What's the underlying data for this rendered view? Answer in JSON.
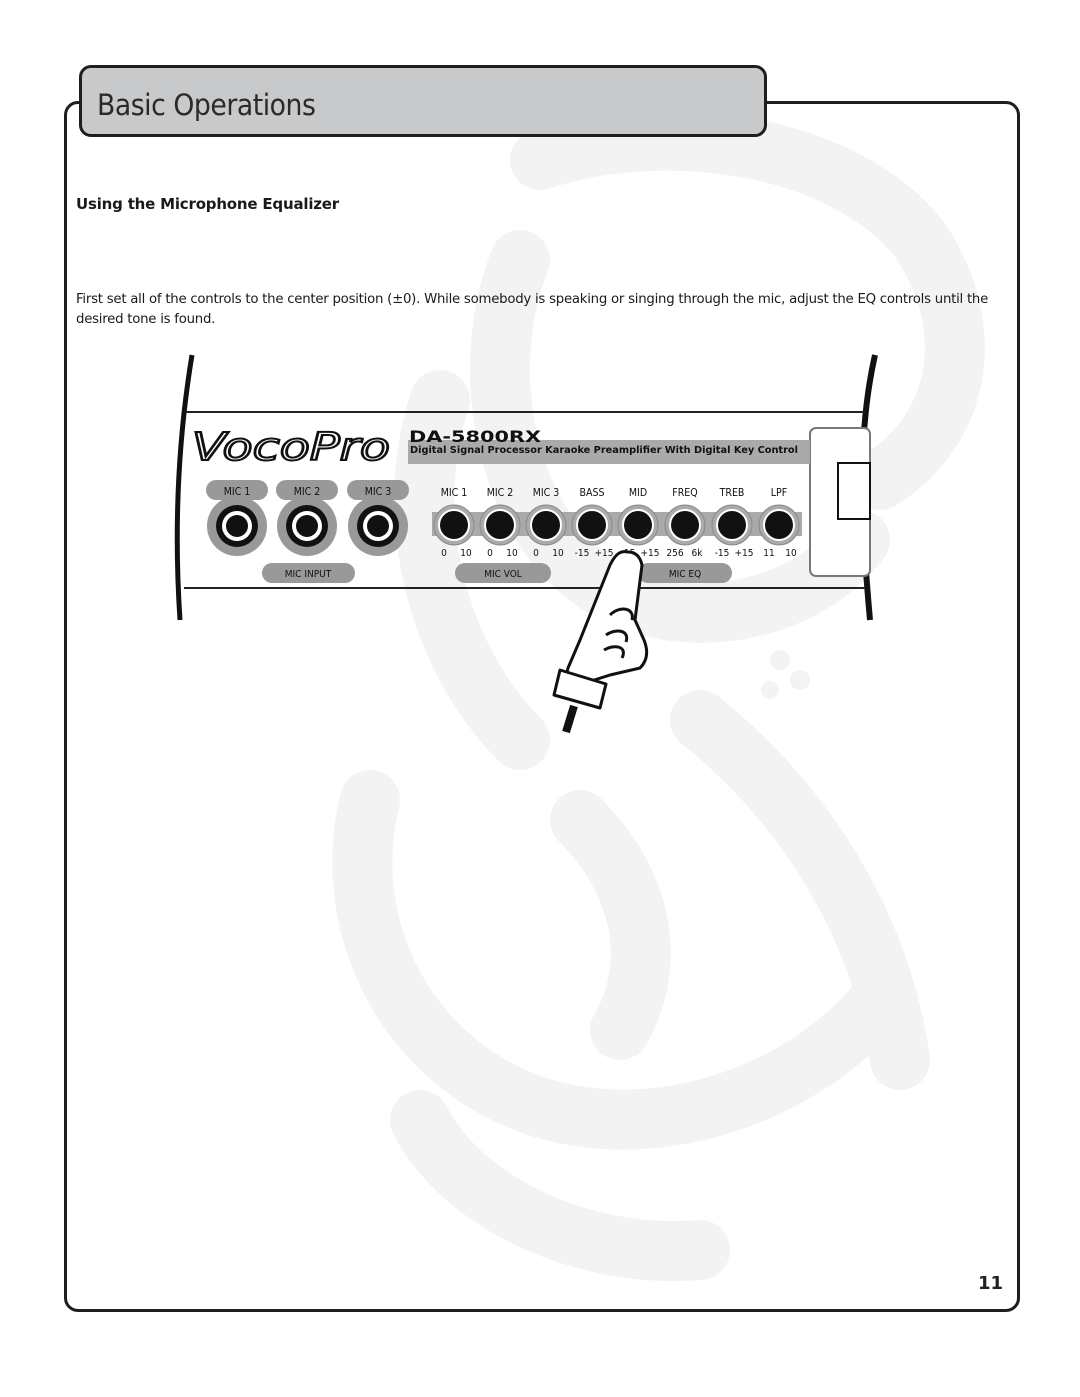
{
  "header": {
    "title": "Basic Operations"
  },
  "section": {
    "heading": "Using the Microphone Equalizer",
    "body": "First set all of the controls to the center position (±0).  While somebody is speaking or singing through the mic, adjust the EQ controls until the desired tone is found."
  },
  "figure": {
    "brand_logo": "VocoPro",
    "model": "DA-5800RX",
    "model_description": "Digital Signal Processor Karaoke Preamplifier With Digital Key Control",
    "mic_inputs": [
      "MIC 1",
      "MIC 2",
      "MIC 3"
    ],
    "mic_input_group": "MIC INPUT",
    "knobs": [
      {
        "label": "MIC 1",
        "min": "0",
        "max": "10"
      },
      {
        "label": "MIC 2",
        "min": "0",
        "max": "10"
      },
      {
        "label": "MIC 3",
        "min": "0",
        "max": "10"
      },
      {
        "label": "BASS",
        "min": "-15",
        "max": "+15"
      },
      {
        "label": "MID",
        "min": "-15",
        "max": "+15"
      },
      {
        "label": "FREQ",
        "min": "256",
        "max": "6k"
      },
      {
        "label": "TREB",
        "min": "-15",
        "max": "+15"
      },
      {
        "label": "LPF",
        "min": "11",
        "max": "10"
      }
    ],
    "mic_vol_group": "MIC VOL",
    "mic_eq_group": "MIC EQ",
    "pointer": "pointing-hand"
  },
  "footer": {
    "page_number": "11"
  }
}
